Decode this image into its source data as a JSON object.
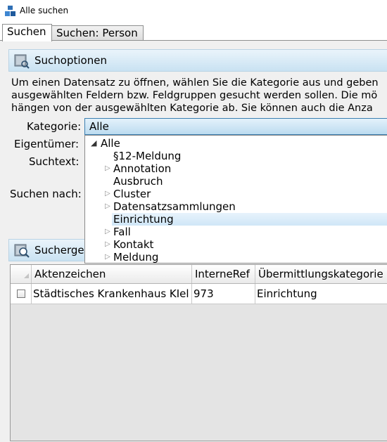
{
  "window": {
    "title": "Alle suchen"
  },
  "tabs": [
    {
      "label": "Suchen",
      "active": true
    },
    {
      "label": "Suchen: Person",
      "active": false
    }
  ],
  "search_options": {
    "header": "Suchoptionen",
    "description_lines": [
      "Um einen Datensatz zu öffnen, wählen Sie die Kategorie aus und geben",
      "ausgewählten Feldern bzw. Feldgruppen gesucht werden sollen. Die mö",
      "hängen von der ausgewählten Kategorie ab. Sie können auch die Anza"
    ],
    "labels": {
      "category": "Kategorie:",
      "owner": "Eigentümer:",
      "search_text": "Suchtext:",
      "search_by": "Suchen nach:"
    },
    "category_value": "Alle"
  },
  "category_dropdown": {
    "root": "Alle",
    "items": [
      {
        "label": "§12-Meldung",
        "expandable": false,
        "selected": false
      },
      {
        "label": "Annotation",
        "expandable": true,
        "selected": false
      },
      {
        "label": "Ausbruch",
        "expandable": false,
        "selected": false
      },
      {
        "label": "Cluster",
        "expandable": true,
        "selected": false
      },
      {
        "label": "Datensatzsammlungen",
        "expandable": true,
        "selected": false
      },
      {
        "label": "Einrichtung",
        "expandable": false,
        "selected": true
      },
      {
        "label": "Fall",
        "expandable": true,
        "selected": false
      },
      {
        "label": "Kontakt",
        "expandable": true,
        "selected": false
      },
      {
        "label": "Meldung",
        "expandable": true,
        "selected": false
      }
    ]
  },
  "results": {
    "header": "Sucherge",
    "columns": [
      "Aktenzeichen",
      "InterneRef",
      "Übermittlungskategorie"
    ],
    "rows": [
      {
        "checked": false,
        "cells": [
          "Städtisches Krankenhaus KIel",
          "973",
          "Einrichtung"
        ]
      }
    ]
  },
  "colors": {
    "header_gradient_top": "#eaf4fb",
    "header_gradient_bottom": "#c9e2f2",
    "selection": "#cfe6f7",
    "panel_bg": "#f0f0f0"
  }
}
